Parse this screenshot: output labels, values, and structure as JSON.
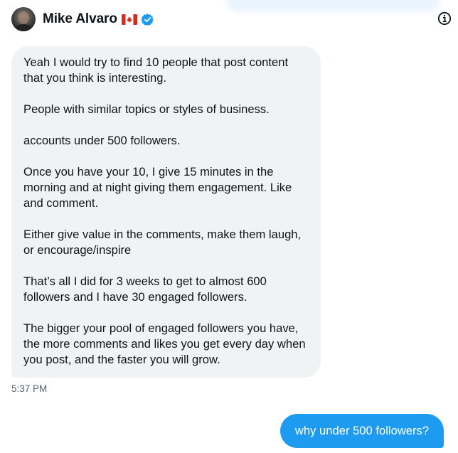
{
  "header": {
    "name": "Mike Alvaro",
    "flag_icon": "canada-flag-icon",
    "verified_icon": "verified-badge-icon",
    "info_icon": "info-icon"
  },
  "messages": {
    "incoming": {
      "paragraphs": [
        "Yeah I would try to find 10 people that post content that you think is interesting.",
        "People with similar topics or styles of business.",
        "accounts under 500 followers.",
        "Once you have your 10, I give 15 minutes in the morning and at night giving them engagement. Like and comment.",
        "Either give value in the comments, make them laugh, or encourage/inspire",
        "That’s all I did for 3 weeks to get to almost 600 followers and I have 30 engaged followers.",
        "The bigger your pool of engaged followers you have, the more comments and likes you get every day when you post, and the faster you will grow."
      ],
      "timestamp": "5:37 PM"
    },
    "outgoing": {
      "text": "why under 500 followers?"
    }
  },
  "colors": {
    "accent": "#1d9bf0",
    "incoming_bubble": "#eff3f4",
    "text": "#0f1419",
    "muted": "#536471"
  }
}
